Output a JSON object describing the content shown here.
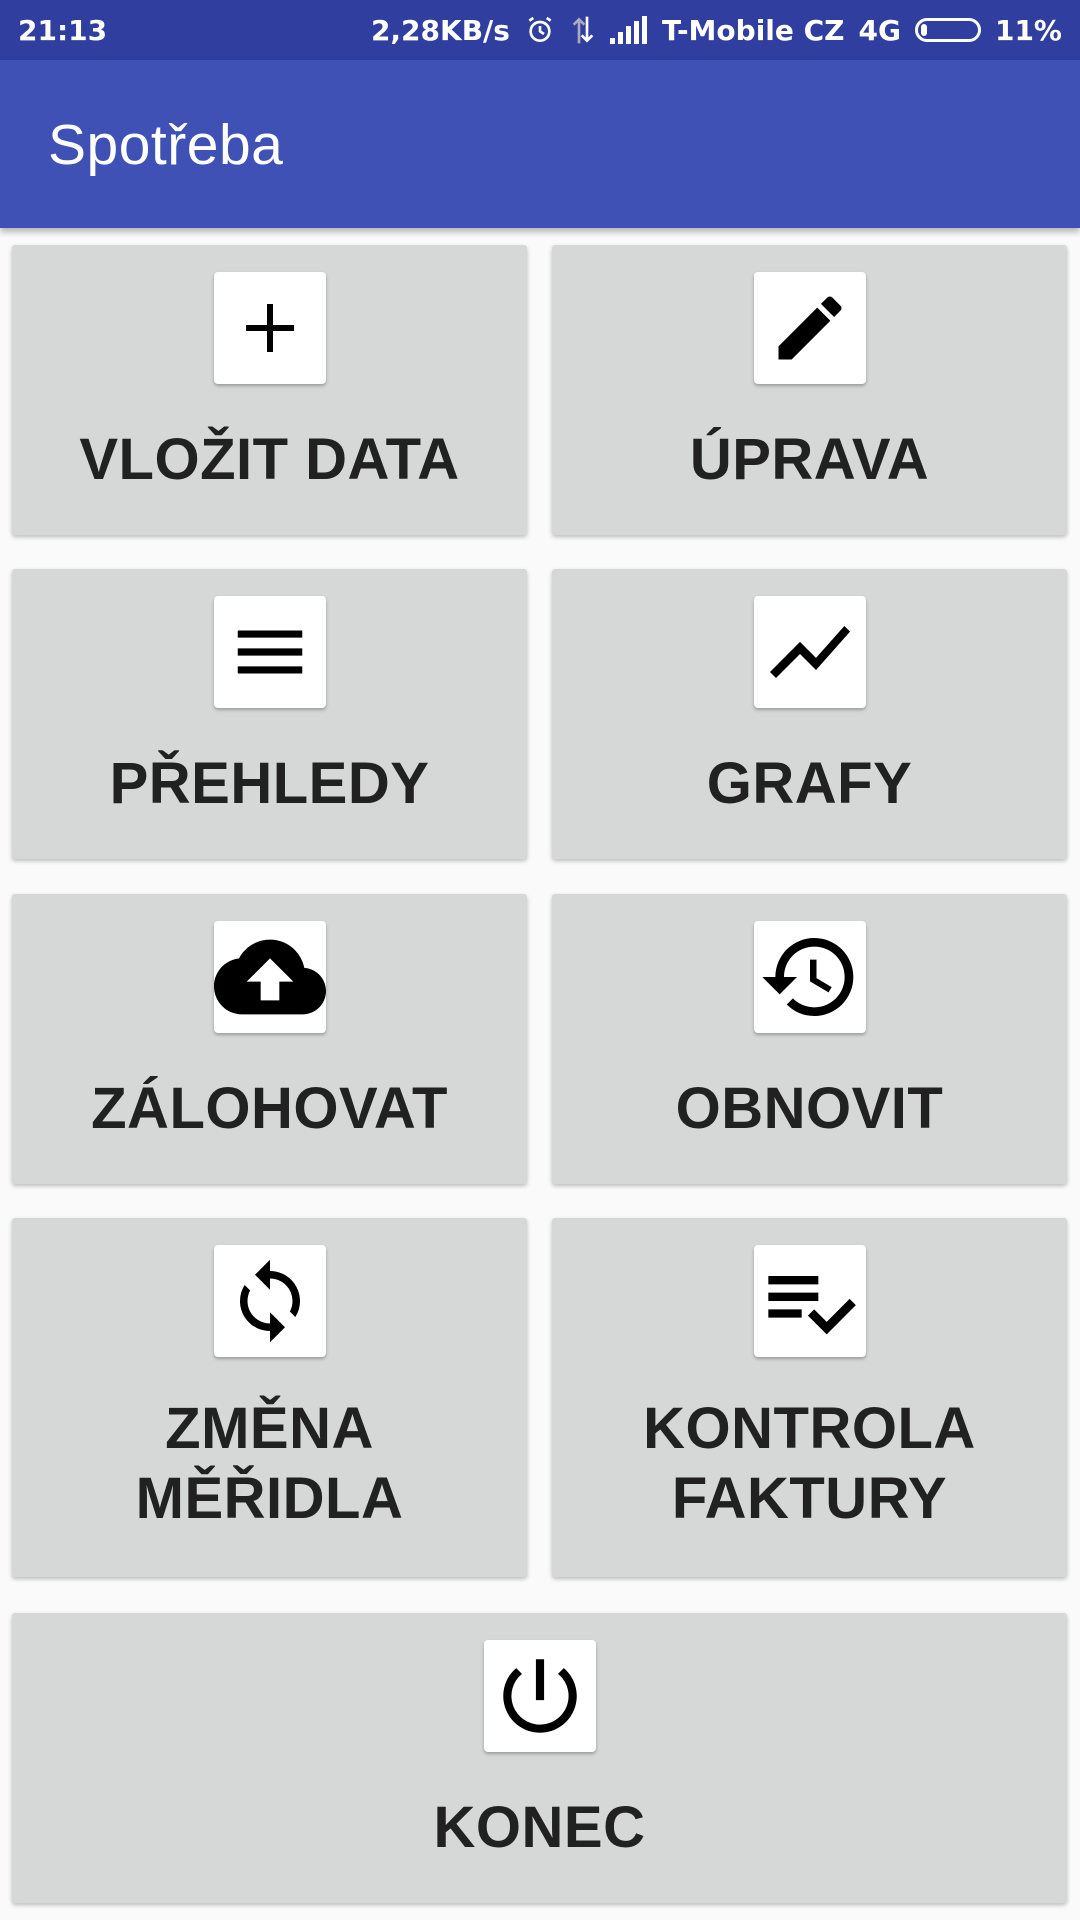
{
  "status_bar": {
    "time": "21:13",
    "speed": "2,28KB/s",
    "carrier": "T-Mobile CZ",
    "network": "4G",
    "battery": "11%"
  },
  "app_bar": {
    "title": "Spotřeba"
  },
  "menu": {
    "insert": {
      "label": "VLOŽIT DATA",
      "icon": "plus-icon"
    },
    "edit": {
      "label": "ÚPRAVA",
      "icon": "pencil-icon"
    },
    "overview": {
      "label": "PŘEHLEDY",
      "icon": "menu-lines-icon"
    },
    "charts": {
      "label": "GRAFY",
      "icon": "trending-line-icon"
    },
    "backup": {
      "label": "ZÁLOHOVAT",
      "icon": "cloud-upload-icon"
    },
    "restore": {
      "label": "OBNOVIT",
      "icon": "history-icon"
    },
    "meter_change": {
      "label_line1": "ZMĚNA",
      "label_line2": "MĚŘIDLA",
      "icon": "sync-icon"
    },
    "invoice_check": {
      "label_line1": "KONTROLA",
      "label_line2": "FAKTURY",
      "icon": "playlist-check-icon"
    },
    "exit": {
      "label": "KONEC",
      "icon": "power-icon"
    }
  },
  "colors": {
    "status_bar": "#303f9f",
    "app_bar": "#3f51b5",
    "tile": "#d6d7d7",
    "label": "#212121"
  }
}
